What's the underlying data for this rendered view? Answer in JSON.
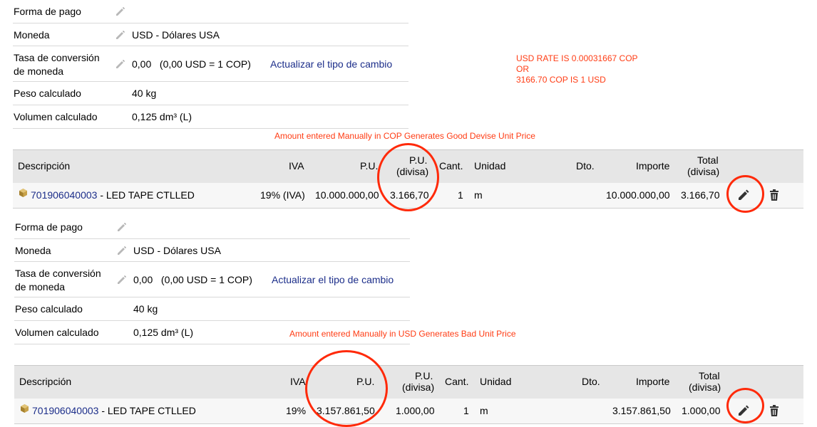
{
  "colors": {
    "link": "#1c2e8a",
    "annotation": "#ff3c14",
    "header_bg": "#e6e6e6"
  },
  "icons": [
    "pencil-icon",
    "trash-icon",
    "product-box-icon"
  ],
  "annotation_top": {
    "line1": "USD RATE IS 0.00031667 COP",
    "line2": "OR",
    "line3": "3166.70 COP IS 1 USD"
  },
  "block1": {
    "forma_de_pago_label": "Forma de pago",
    "moneda_label": "Moneda",
    "moneda_value": "USD - Dólares USA",
    "tasa_label_1": "Tasa de conversión",
    "tasa_label_2": "de moneda",
    "tasa_value": "0,00   (0,00 USD = 1 COP)",
    "tasa_link": "Actualizar el tipo de cambio",
    "peso_label": "Peso calculado",
    "peso_value": "40 kg",
    "volumen_label": "Volumen calculado",
    "volumen_value": "0,125 dm³ (L)",
    "note": "Amount entered Manually in COP Generates Good Devise Unit Price"
  },
  "table1": {
    "headers": {
      "descripcion": "Descripción",
      "iva": "IVA",
      "pu": "P.U.",
      "pu_divisa_1": "P.U.",
      "pu_divisa_2": "(divisa)",
      "cant": "Cant.",
      "unidad": "Unidad",
      "dto": "Dto.",
      "importe": "Importe",
      "total_1": "Total",
      "total_2": "(divisa)"
    },
    "row": {
      "ref": "701906040003",
      "desc": " - LED TAPE CTLLED",
      "iva": "19% (IVA)",
      "pu": "10.000.000,00",
      "pu_divisa": "3.166,70",
      "cant": "1",
      "unidad": "m",
      "dto": "",
      "importe": "10.000.000,00",
      "total_divisa": "3.166,70"
    }
  },
  "block2": {
    "forma_de_pago_label": "Forma de pago",
    "moneda_label": "Moneda",
    "moneda_value": "USD - Dólares USA",
    "tasa_label_1": "Tasa de conversión",
    "tasa_label_2": "de moneda",
    "tasa_value": "0,00   (0,00 USD = 1 COP)",
    "tasa_link": "Actualizar el tipo de cambio",
    "peso_label": "Peso calculado",
    "peso_value": "40 kg",
    "volumen_label": "Volumen calculado",
    "volumen_value": "0,125 dm³ (L)",
    "note": "Amount entered Manually in USD Generates Bad Unit Price"
  },
  "table2": {
    "headers": {
      "descripcion": "Descripción",
      "iva": "IVA",
      "pu": "P.U.",
      "pu_divisa_1": "P.U.",
      "pu_divisa_2": "(divisa)",
      "cant": "Cant.",
      "unidad": "Unidad",
      "dto": "Dto.",
      "importe": "Importe",
      "total_1": "Total",
      "total_2": "(divisa)"
    },
    "row": {
      "ref": "701906040003",
      "desc": " - LED TAPE CTLLED",
      "iva": "19%",
      "pu": "3.157.861,50",
      "pu_divisa": "1.000,00",
      "cant": "1",
      "unidad": "m",
      "dto": "",
      "importe": "3.157.861,50",
      "total_divisa": "1.000,00"
    }
  }
}
